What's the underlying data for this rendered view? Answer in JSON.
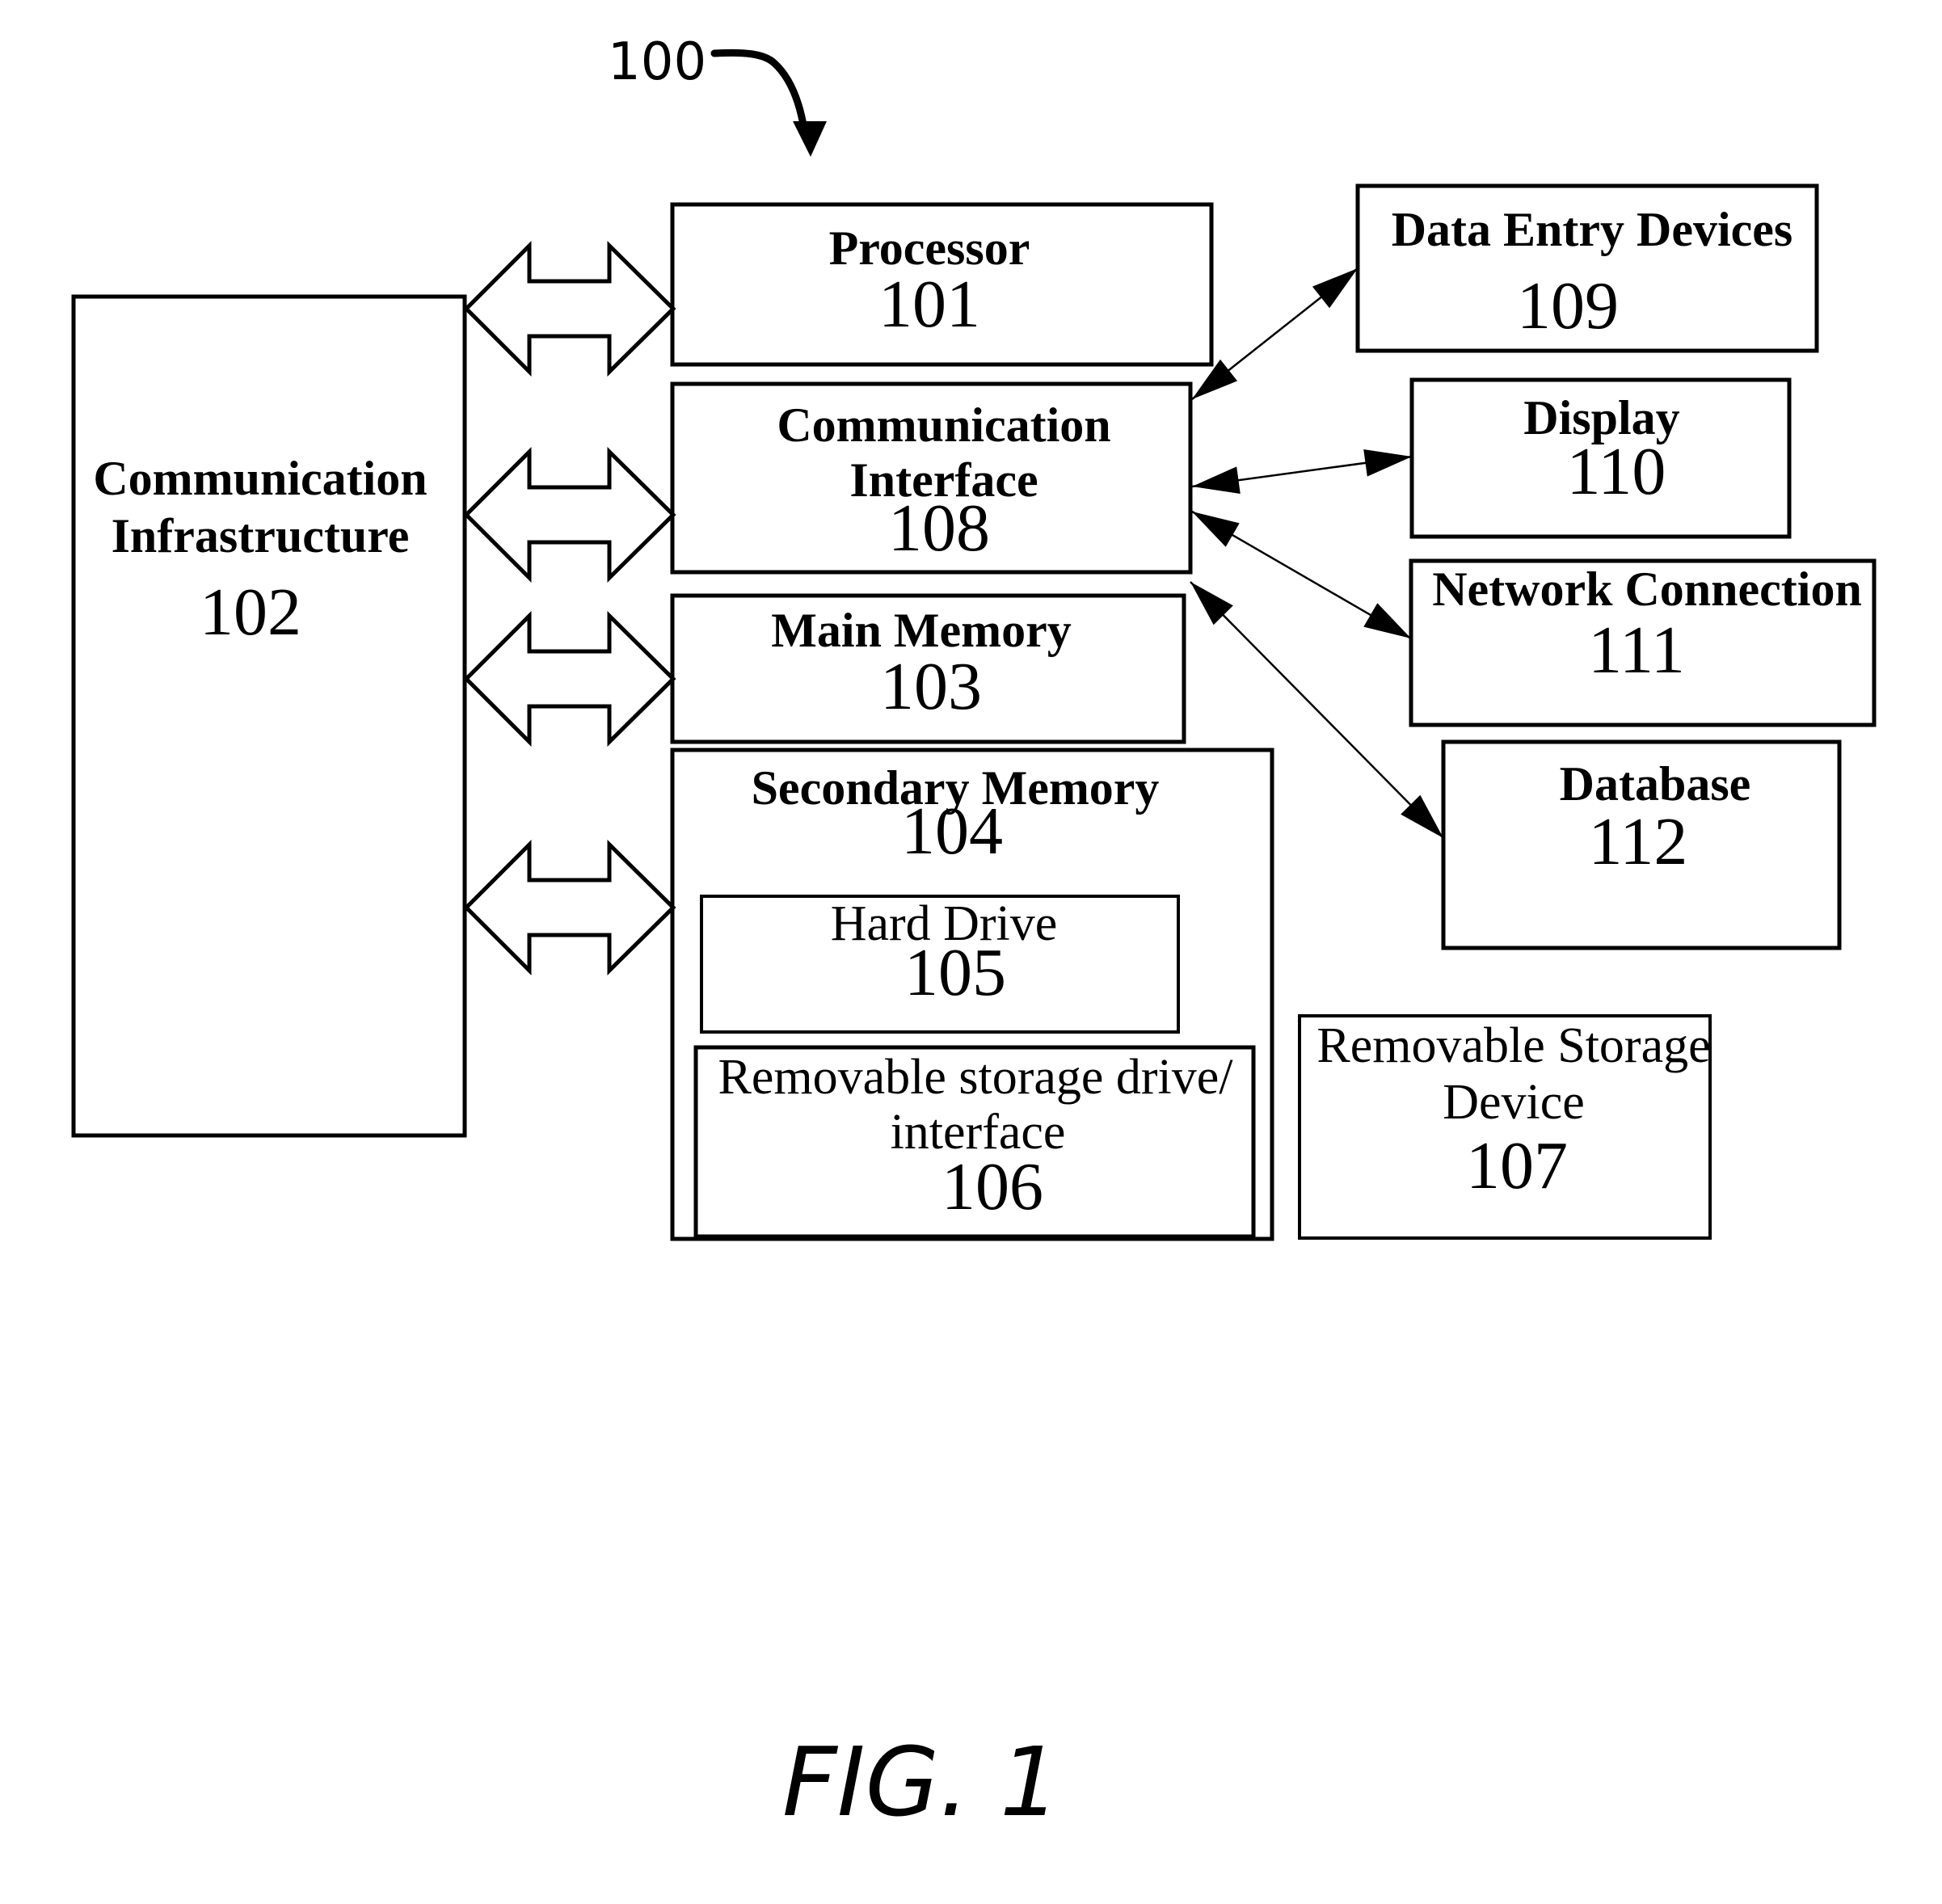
{
  "figure": {
    "reference_label": "100",
    "caption": "FIG. 1"
  },
  "blocks": {
    "comm_infrastructure": {
      "lines": [
        "Communication",
        "Infrastructure"
      ],
      "number": "102"
    },
    "processor": {
      "lines": [
        "Processor"
      ],
      "number": "101"
    },
    "comm_interface": {
      "lines": [
        "Communication",
        "Interface"
      ],
      "number": "108"
    },
    "main_memory": {
      "lines": [
        "Main Memory"
      ],
      "number": "103"
    },
    "secondary_memory": {
      "lines": [
        "Secondary Memory"
      ],
      "number": "104"
    },
    "hard_drive": {
      "lines": [
        "Hard Drive"
      ],
      "number": "105"
    },
    "removable_drive": {
      "lines": [
        "Removable storage drive/",
        "interface"
      ],
      "number": "106"
    },
    "removable_device": {
      "lines": [
        "Removable Storage",
        "Device"
      ],
      "number": "107"
    },
    "data_entry": {
      "lines": [
        "Data Entry Devices"
      ],
      "number": "109"
    },
    "display": {
      "lines": [
        "Display"
      ],
      "number": "110"
    },
    "network": {
      "lines": [
        "Network Connection"
      ],
      "number": "111"
    },
    "database": {
      "lines": [
        "Database"
      ],
      "number": "112"
    }
  },
  "bus_connections": [
    {
      "from": "Communication Infrastructure",
      "to": "Processor"
    },
    {
      "from": "Communication Infrastructure",
      "to": "Communication Interface"
    },
    {
      "from": "Communication Infrastructure",
      "to": "Main Memory"
    },
    {
      "from": "Communication Infrastructure",
      "to": "Secondary Memory"
    }
  ],
  "interface_connections": [
    {
      "from": "Communication Interface",
      "to": "Data Entry Devices",
      "bidirectional": true
    },
    {
      "from": "Communication Interface",
      "to": "Display",
      "bidirectional": true
    },
    {
      "from": "Communication Interface",
      "to": "Network Connection",
      "bidirectional": true
    },
    {
      "from": "Communication Interface",
      "to": "Database",
      "bidirectional": true
    }
  ]
}
